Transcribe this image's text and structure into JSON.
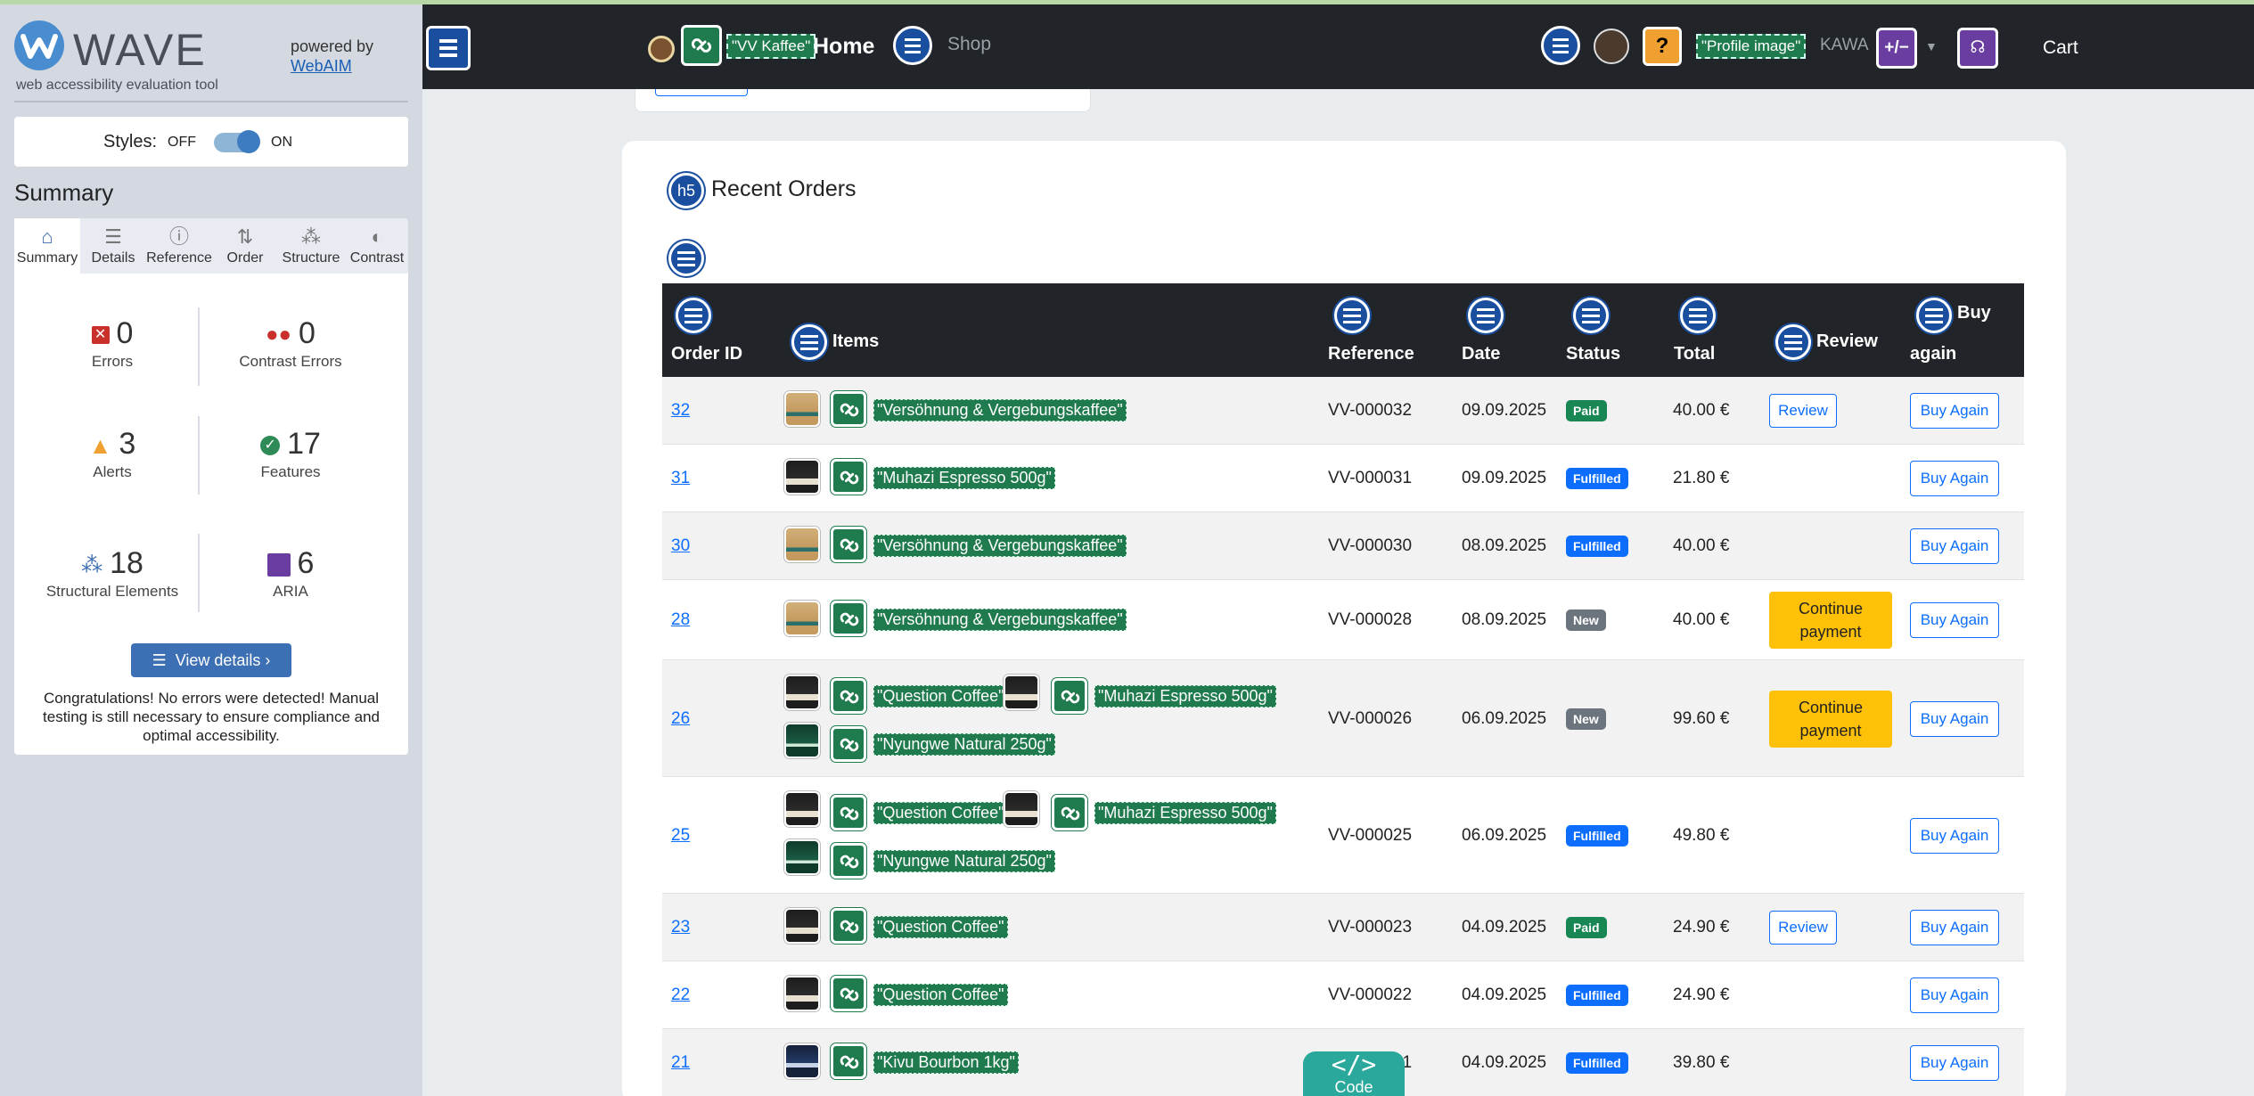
{
  "wave": {
    "name": "WAVE",
    "tagline": "web accessibility evaluation tool",
    "powered_by": "powered by",
    "powered_link": "WebAIM",
    "styles_label": "Styles:",
    "styles_off": "OFF",
    "styles_on": "ON",
    "summary_title": "Summary",
    "tabs": [
      {
        "label": "Summary",
        "icon": "home-icon"
      },
      {
        "label": "Details",
        "icon": "list-icon"
      },
      {
        "label": "Reference",
        "icon": "info-icon"
      },
      {
        "label": "Order",
        "icon": "order-icon"
      },
      {
        "label": "Structure",
        "icon": "structure-icon"
      },
      {
        "label": "Contrast",
        "icon": "contrast-icon"
      }
    ],
    "stats": {
      "errors": {
        "value": "0",
        "label": "Errors"
      },
      "contrast_errors": {
        "value": "0",
        "label": "Contrast Errors"
      },
      "alerts": {
        "value": "3",
        "label": "Alerts"
      },
      "features": {
        "value": "17",
        "label": "Features"
      },
      "structural": {
        "value": "18",
        "label": "Structural Elements"
      },
      "aria": {
        "value": "6",
        "label": "ARIA"
      }
    },
    "view_details": "View details ›",
    "congrats": "Congratulations! No errors were detected! Manual testing is still necessary to ensure compliance and optimal accessibility."
  },
  "nav": {
    "brand_alt": "\"VV Kaffee\"",
    "home": "Home",
    "shop": "Shop",
    "profile_alt": "\"Profile image\"",
    "user": "KAWA",
    "aria_badge": "+/−",
    "cart": "Cart",
    "help_glyph": "?"
  },
  "orders": {
    "heading_tag": "h5",
    "title": "Recent Orders",
    "columns": {
      "order_id": "Order ID",
      "items": "Items",
      "reference": "Reference",
      "date": "Date",
      "status": "Status",
      "total": "Total",
      "review": "Review",
      "buy_again_1": "Buy",
      "buy_again_2": "again"
    },
    "rows": [
      {
        "id": "32",
        "items": [
          {
            "name": "\"Versöhnung & Vergebungskaffee\"",
            "thumb": "kraft"
          }
        ],
        "ref": "VV-000032",
        "date": "09.09.2025",
        "status": "Paid",
        "total": "40.00 €",
        "review": "Review",
        "action": "Buy Again"
      },
      {
        "id": "31",
        "items": [
          {
            "name": "\"Muhazi Espresso 500g\"",
            "thumb": "black"
          }
        ],
        "ref": "VV-000031",
        "date": "09.09.2025",
        "status": "Fulfilled",
        "total": "21.80 €",
        "review": "",
        "action": "Buy Again"
      },
      {
        "id": "30",
        "items": [
          {
            "name": "\"Versöhnung & Vergebungskaffee\"",
            "thumb": "kraft"
          }
        ],
        "ref": "VV-000030",
        "date": "08.09.2025",
        "status": "Fulfilled",
        "total": "40.00 €",
        "review": "",
        "action": "Buy Again"
      },
      {
        "id": "28",
        "items": [
          {
            "name": "\"Versöhnung & Vergebungskaffee\"",
            "thumb": "kraft"
          }
        ],
        "ref": "VV-000028",
        "date": "08.09.2025",
        "status": "New",
        "total": "40.00 €",
        "review": "Continue payment",
        "action": "Buy Again"
      },
      {
        "id": "26",
        "items": [
          {
            "name": "\"Question Coffee\"",
            "thumb": "black"
          },
          {
            "name": "\"Muhazi Espresso 500g\"",
            "thumb": "black"
          },
          {
            "name": "\"Nyungwe Natural 250g\"",
            "thumb": "green"
          }
        ],
        "ref": "VV-000026",
        "date": "06.09.2025",
        "status": "New",
        "total": "99.60 €",
        "review": "Continue payment",
        "action": "Buy Again"
      },
      {
        "id": "25",
        "items": [
          {
            "name": "\"Question Coffee\"",
            "thumb": "black"
          },
          {
            "name": "\"Muhazi Espresso 500g\"",
            "thumb": "black"
          },
          {
            "name": "\"Nyungwe Natural 250g\"",
            "thumb": "green"
          }
        ],
        "ref": "VV-000025",
        "date": "06.09.2025",
        "status": "Fulfilled",
        "total": "49.80 €",
        "review": "",
        "action": "Buy Again"
      },
      {
        "id": "23",
        "items": [
          {
            "name": "\"Question Coffee\"",
            "thumb": "black"
          }
        ],
        "ref": "VV-000023",
        "date": "04.09.2025",
        "status": "Paid",
        "total": "24.90 €",
        "review": "Review",
        "action": "Buy Again"
      },
      {
        "id": "22",
        "items": [
          {
            "name": "\"Question Coffee\"",
            "thumb": "black"
          }
        ],
        "ref": "VV-000022",
        "date": "04.09.2025",
        "status": "Fulfilled",
        "total": "24.90 €",
        "review": "",
        "action": "Buy Again"
      },
      {
        "id": "21",
        "items": [
          {
            "name": "\"Kivu Bourbon 1kg\"",
            "thumb": "navy"
          }
        ],
        "ref": "VV-000021",
        "date": "04.09.2025",
        "status": "Fulfilled",
        "total": "39.80 €",
        "review": "",
        "action": "Buy Again"
      }
    ]
  },
  "code_button": {
    "symbol": "</>",
    "label": "Code"
  },
  "colors": {
    "wave_blue": "#3d6fb4",
    "navbar": "#212529",
    "alt_green": "#1f7a4d",
    "primary": "#0d6efd",
    "warning": "#ffc107"
  }
}
